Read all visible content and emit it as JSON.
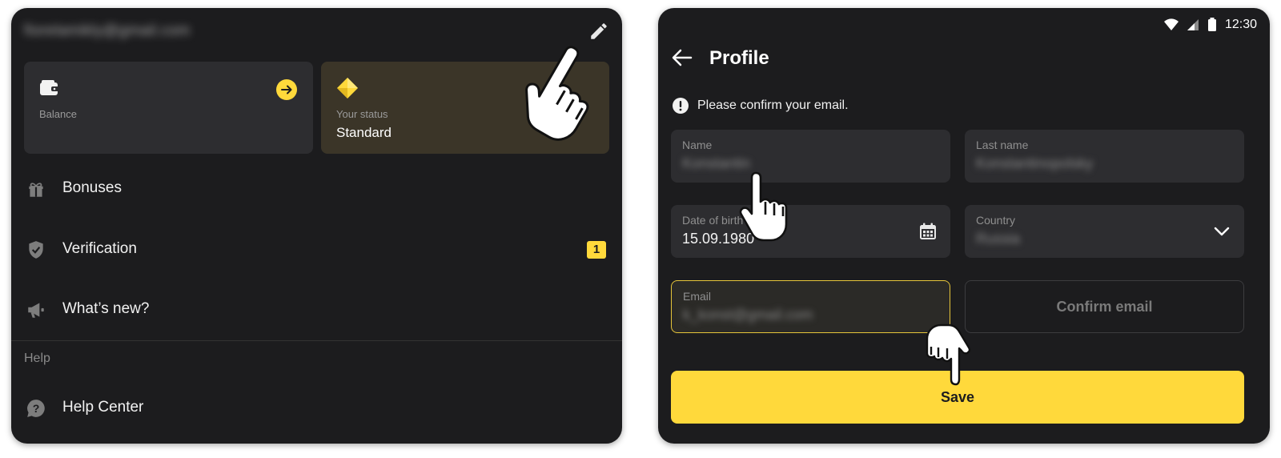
{
  "left": {
    "account_email": "fiorelamikly@gmail.com",
    "balance": {
      "label": "Balance"
    },
    "status": {
      "label": "Your status",
      "value": "Standard"
    },
    "menu": [
      {
        "label": "Bonuses",
        "icon": "gift-icon"
      },
      {
        "label": "Verification",
        "icon": "shield-check-icon",
        "badge": "1"
      },
      {
        "label": "What’s new?",
        "icon": "megaphone-icon"
      }
    ],
    "help_section": {
      "header": "Help",
      "items": [
        {
          "label": "Help Center",
          "icon": "help-bubble-icon"
        }
      ]
    }
  },
  "right": {
    "status_bar": {
      "time": "12:30"
    },
    "title": "Profile",
    "notice": "Please confirm your email.",
    "fields": {
      "name": {
        "label": "Name",
        "value": "Konstantin"
      },
      "last_name": {
        "label": "Last name",
        "value": "Konstantinopolsky"
      },
      "dob": {
        "label": "Date of birth",
        "value": "15.09.1980"
      },
      "country": {
        "label": "Country",
        "value": "Russia"
      },
      "email": {
        "label": "Email",
        "value": "k_konst@gmail.com"
      }
    },
    "confirm_label": "Confirm email",
    "save_label": "Save"
  },
  "colors": {
    "background": "#1c1c1e",
    "accent": "#ffd93b",
    "card": "#2d2d30",
    "status_card": "#3b3528"
  }
}
